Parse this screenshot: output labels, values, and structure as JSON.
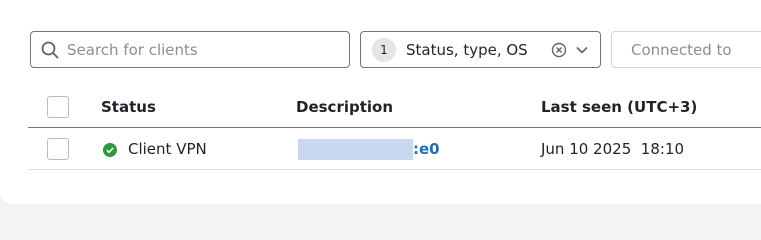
{
  "search": {
    "placeholder": "Search for clients",
    "value": ""
  },
  "filter": {
    "count": "1",
    "label": "Status, type, OS"
  },
  "connected_filter": {
    "placeholder": "Connected to"
  },
  "table": {
    "columns": [
      "Status",
      "Description",
      "Last seen (UTC+3)"
    ],
    "rows": [
      {
        "status": "Client VPN",
        "status_color": "#2e9a3e",
        "description_suffix": ":e0",
        "last_seen": "Jun 10 2025  18:10"
      }
    ]
  },
  "colors": {
    "link": "#1f6fb8",
    "online": "#2e9a3e"
  },
  "icons": [
    "search-icon",
    "clear-icon",
    "chevron-down-icon",
    "status-online-icon"
  ]
}
